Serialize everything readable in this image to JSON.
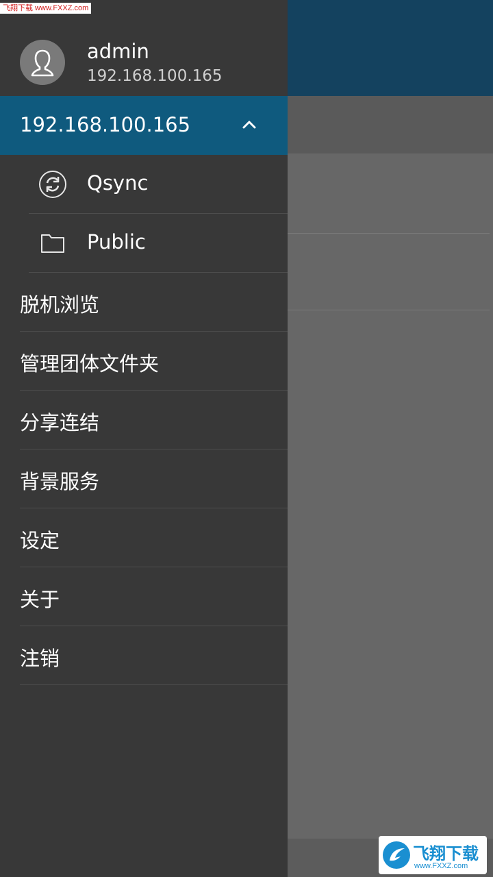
{
  "profile": {
    "username": "admin",
    "host": "192.168.100.165"
  },
  "server": {
    "label": "192.168.100.165",
    "expanded": true
  },
  "sub_items": [
    {
      "label": "Qsync",
      "icon": "sync-icon"
    },
    {
      "label": "Public",
      "icon": "folder-icon"
    }
  ],
  "menu": [
    {
      "label": "脱机浏览"
    },
    {
      "label": "管理团体文件夹"
    },
    {
      "label": "分享连结"
    },
    {
      "label": "背景服务"
    },
    {
      "label": "设定"
    },
    {
      "label": "关于"
    },
    {
      "label": "注销"
    }
  ],
  "watermark": {
    "top_text": "飞翔下载 www.FXXZ.com",
    "logo_text": "飞翔下载",
    "logo_url": "www.FXXZ.com"
  },
  "colors": {
    "accent": "#0f5a7e",
    "header": "#14425f",
    "drawer": "#383838"
  }
}
